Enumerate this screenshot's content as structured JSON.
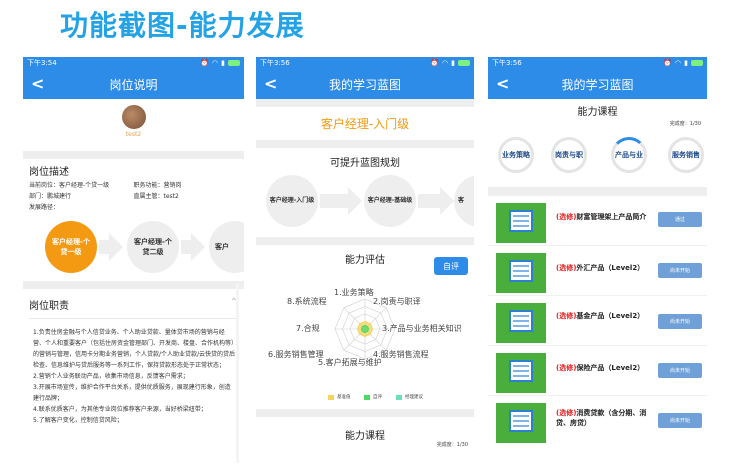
{
  "page_title": "功能截图-能力发展",
  "colors": {
    "primary": "#2c8ce8",
    "accent": "#f39a12",
    "title": "#23a3e6"
  },
  "phone1": {
    "time": "下午3:54",
    "nav_title": "岗位说明",
    "username": "test2",
    "desc_heading": "岗位描述",
    "info": {
      "current_post": "当前岗位：客户经理-个贷一级",
      "job_function": "职务功能：营销岗",
      "department": "部门：鹏城建行",
      "supervisor": "直属主管：test2",
      "dev_path": "发展路径："
    },
    "path": [
      "客户经理-个贷一级",
      "客户经理-个贷二级",
      "客户"
    ],
    "duty_heading": "岗位职责",
    "duties": [
      "1.负责住房金融与个人信贷业务、个人助业贷款、量体贷市场的营销与经营、个人和重要客户（包括住房资金管理部门、开发商、楼盘、合作机构等）的营销与管理，信用卡分期业务营销，个人贷款/个人助业贷款/云快贷的贷后检查、信息维护与贷后服务等一系列工作，保持贷款形态处于正常状态；",
      "2.营销个人业务联动产品，收集市场信息，反馈客户需求；",
      "3.开展市场宣传，维护合作平台关系，提供优质服务，展现建行形象，创造建行品牌；",
      "4.联系优质客户，为其他专业岗位推荐客户来源，当好桥梁纽带；",
      "5.了解客户变化，控制信贷风险；"
    ]
  },
  "phone2": {
    "time": "下午3:56",
    "nav_title": "我的学习蓝图",
    "level": "客户经理-入门级",
    "upgrade_heading": "可提升蓝图规划",
    "path": [
      "客户经理-入门级",
      "客户经理-基础级",
      "客"
    ],
    "ability_heading": "能力评估",
    "self_eval": "自评",
    "radar": {
      "axes": [
        "1.业务策略",
        "2.岗责与职译",
        "3.产品与业务相关知识",
        "4.服务销售流程",
        "5.客户拓展与维护",
        "6.服务销售管理",
        "7.合规",
        "8.系统流程"
      ],
      "series": [
        {
          "name": "基准值",
          "color": "#f4d35e",
          "values": [
            0.25,
            0.25,
            0.25,
            0.25,
            0.25,
            0.25,
            0.25,
            0.25
          ]
        },
        {
          "name": "自评",
          "color": "#4cd964",
          "values": [
            0.12,
            0.12,
            0.12,
            0.12,
            0.12,
            0.12,
            0.12,
            0.12
          ]
        },
        {
          "name": "经理建议",
          "color": "#6ee0b8",
          "values": [
            0.0,
            0.0,
            0.0,
            0.0,
            0.0,
            0.0,
            0.0,
            0.0
          ]
        }
      ]
    },
    "course_heading": "能力课程",
    "progress": "完成度：1/30"
  },
  "phone3": {
    "time": "下午3:56",
    "nav_title": "我的学习蓝图",
    "course_heading": "能力课程",
    "progress": "完成度：1/30",
    "rings": [
      {
        "label": "业务策略",
        "progress": 0.0
      },
      {
        "label": "岗责与职",
        "progress": 0.0
      },
      {
        "label": "产品与业",
        "progress": 0.12
      },
      {
        "label": "服务销售",
        "progress": 0.0
      }
    ],
    "courses": [
      {
        "opt": "(选修)",
        "name": "财富管理架上产品简介",
        "btn": "通过"
      },
      {
        "opt": "(选修)",
        "name": "外汇产品（Level2）",
        "btn": "尚未开始"
      },
      {
        "opt": "(选修)",
        "name": "基金产品（Level2）",
        "btn": "尚未开始"
      },
      {
        "opt": "(选修)",
        "name": "保险产品（Level2）",
        "btn": "尚未开始"
      },
      {
        "opt": "(选修)",
        "name": "消费贷款（含分期、消贷、房贷）",
        "btn": "尚未开始"
      }
    ]
  }
}
